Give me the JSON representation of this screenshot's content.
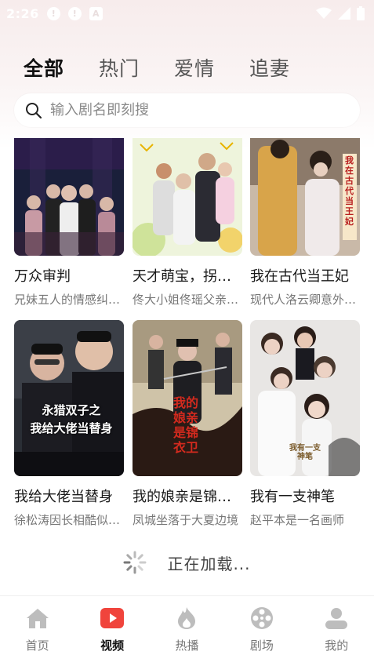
{
  "status_bar": {
    "time": "2:26"
  },
  "tabs": [
    {
      "label": "全部",
      "active": true
    },
    {
      "label": "热门",
      "active": false
    },
    {
      "label": "爱情",
      "active": false
    },
    {
      "label": "追妻",
      "active": false
    }
  ],
  "search": {
    "placeholder": "输入剧名即刻搜"
  },
  "dramas": [
    {
      "title": "万众审判",
      "desc": "兄妹五人的情感纠葛，真相终将大白"
    },
    {
      "title": "天才萌宝，拐个爹地宠妈咪",
      "desc": "佟大小姐佟瑶父亲离世后"
    },
    {
      "title": "我在古代当王妃",
      "desc": "现代人洛云卿意外穿越"
    },
    {
      "title": "我给大佬当替身",
      "desc": "徐松涛因长相酷似大佬"
    },
    {
      "title": "我的娘亲是锦衣卫",
      "desc": "凤城坐落于大夏边境"
    },
    {
      "title": "我有一支神笔",
      "desc": "赵平本是一名画师"
    }
  ],
  "poster_texts": {
    "card3": "我在古代当王妃",
    "card4_line1": "永猎双子之",
    "card4_line2": "我给大佬当替身",
    "card5": "我的娘亲是锦衣卫",
    "card6": "我有一支神笔"
  },
  "loading": {
    "text": "正在加载..."
  },
  "bottom_nav": [
    {
      "label": "首页",
      "icon": "home-icon",
      "active": false
    },
    {
      "label": "视频",
      "icon": "video-play-icon",
      "active": true
    },
    {
      "label": "热播",
      "icon": "flame-icon",
      "active": false
    },
    {
      "label": "剧场",
      "icon": "film-reel-icon",
      "active": false
    },
    {
      "label": "我的",
      "icon": "user-icon",
      "active": false
    }
  ],
  "colors": {
    "accent": "#f0443c",
    "nav_inactive": "#bdbdbd"
  }
}
